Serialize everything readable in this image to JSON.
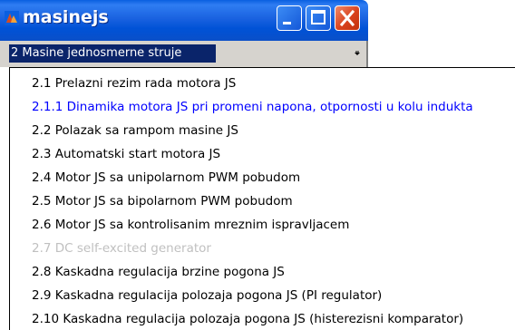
{
  "window": {
    "title": "masinejs",
    "icon": "app-logo-icon",
    "buttons": {
      "minimize": "minimize-icon",
      "maximize": "maximize-icon",
      "close": "close-icon"
    },
    "colors": {
      "titlebar": "#0a5fe0",
      "close": "#d8411c"
    }
  },
  "combo": {
    "selected": "2 Masine jednosmerne struje",
    "arrow_icon": "dropdown-arrow-icon",
    "highlight": "#0a246a"
  },
  "list": {
    "items": [
      {
        "label": "2.1 Prelazni rezim rada motora JS",
        "state": "normal"
      },
      {
        "label": "2.1.1 Dinamika motora JS pri promeni napona, otpornosti u kolu indukta",
        "state": "selected"
      },
      {
        "label": "2.2  Polazak sa rampom masine JS",
        "state": "normal"
      },
      {
        "label": "2.3 Automatski start motora JS",
        "state": "normal"
      },
      {
        "label": "2.4 Motor JS sa unipolarnom PWM pobudom",
        "state": "normal"
      },
      {
        "label": "2.5 Motor JS sa bipolarnom PWM pobudom",
        "state": "normal"
      },
      {
        "label": "2.6 Motor JS sa kontrolisanim mreznim ispravljacem",
        "state": "normal"
      },
      {
        "label": "2.7  DC self-excited generator",
        "state": "disabled"
      },
      {
        "label": "2.8 Kaskadna regulacija brzine pogona JS",
        "state": "normal"
      },
      {
        "label": "2.9 Kaskadna regulacija polozaja pogona JS (PI regulator)",
        "state": "normal"
      },
      {
        "label": "2.10 Kaskadna regulacija polozaja pogona JS (histerezisni komparator)",
        "state": "normal"
      }
    ],
    "colors": {
      "normal": "#000000",
      "selected": "#0000ff",
      "disabled": "#c0c0c0"
    }
  }
}
